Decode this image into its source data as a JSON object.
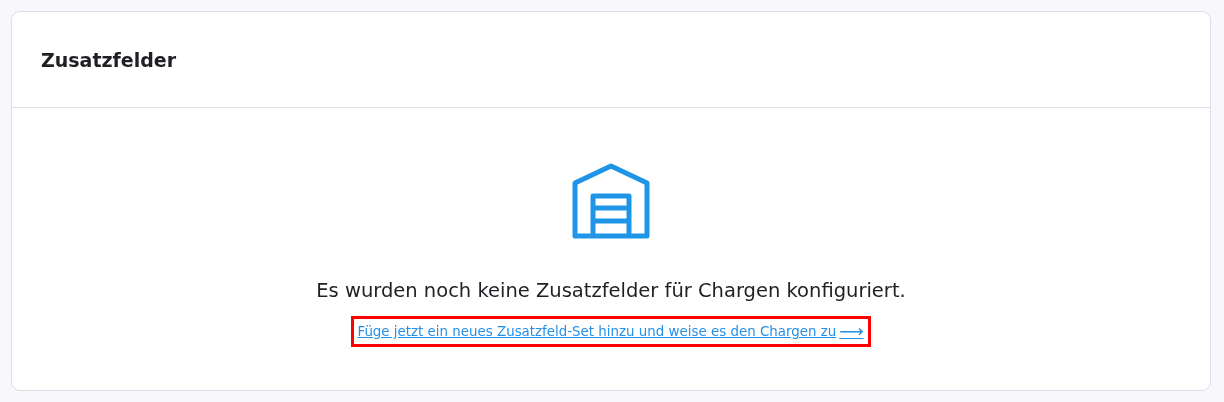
{
  "card": {
    "title": "Zusatzfelder"
  },
  "empty_state": {
    "message": "Es wurden noch keine Zusatzfelder für Chargen konfiguriert.",
    "link": "Füge jetzt ein neues Zusatzfeld-Set hinzu und weise es den Chargen zu",
    "link_arrow": "⟶"
  }
}
